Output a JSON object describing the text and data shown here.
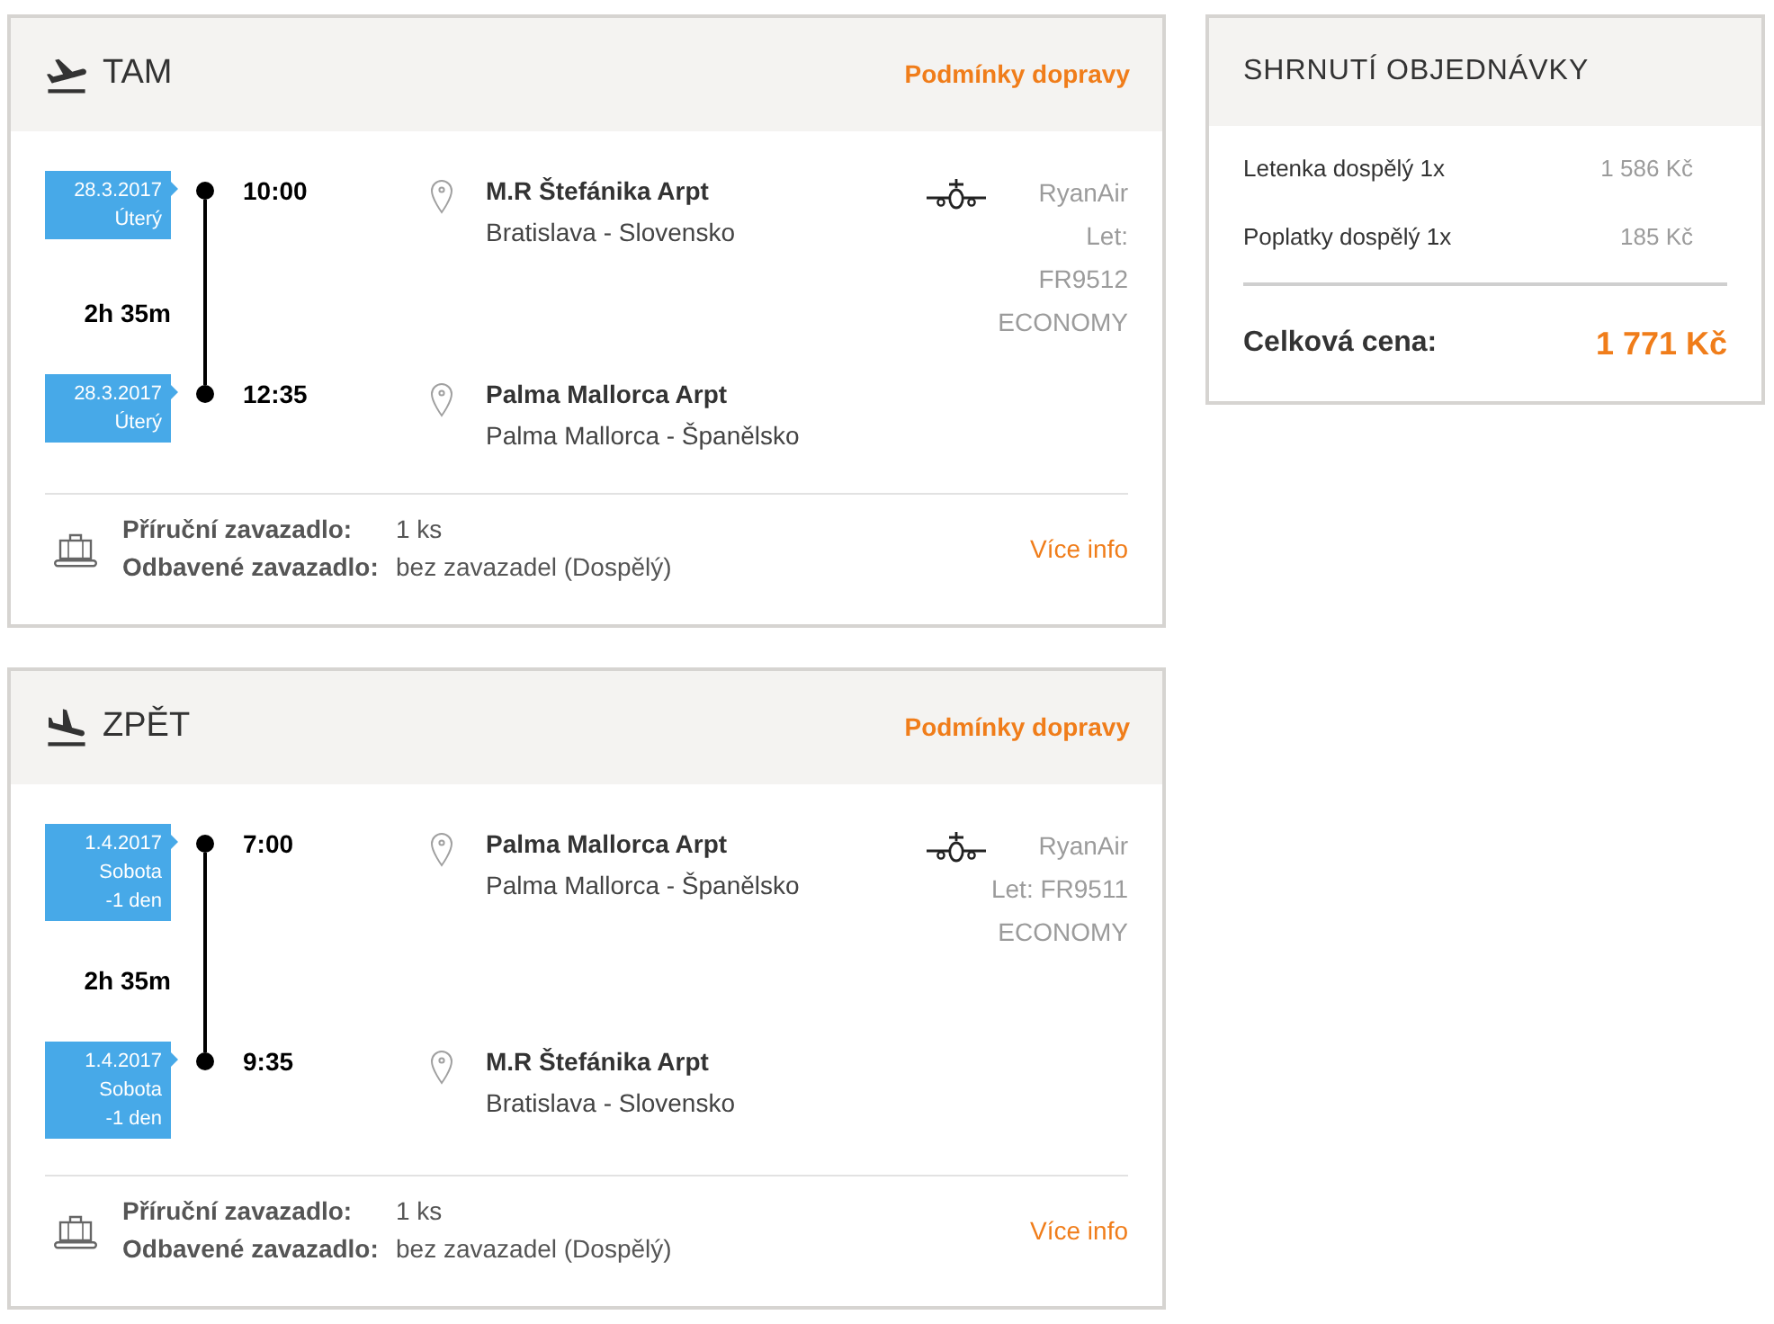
{
  "trips": [
    {
      "kind": "departure",
      "title": "TAM",
      "conditions_link": "Podmínky dopravy",
      "stops": [
        {
          "date": "28.3.2017",
          "day": "Úterý",
          "time": "10:00",
          "airport": "M.R Štefánika Arpt",
          "city": "Bratislava - Slovensko"
        },
        {
          "date": "28.3.2017",
          "day": "Úterý",
          "time": "12:35",
          "airport": "Palma Mallorca Arpt",
          "city": "Palma Mallorca - Španělsko"
        }
      ],
      "duration": "2h 35m",
      "carrier": [
        "RyanAir",
        "Let:",
        "FR9512",
        "ECONOMY"
      ],
      "baggage": [
        {
          "label": "Příruční zavazadlo:",
          "value": "1 ks"
        },
        {
          "label": "Odbavené zavazadlo:",
          "value": "bez zavazadel (Dospělý)"
        }
      ],
      "more_info": "Více info"
    },
    {
      "kind": "return",
      "title": "ZPĚT",
      "conditions_link": "Podmínky dopravy",
      "stops": [
        {
          "date": "1.4.2017",
          "day": "Sobota",
          "offset": "-1 den",
          "time": "7:00",
          "airport": "Palma Mallorca Arpt",
          "city": "Palma Mallorca - Španělsko"
        },
        {
          "date": "1.4.2017",
          "day": "Sobota",
          "offset": "-1 den",
          "time": "9:35",
          "airport": "M.R Štefánika Arpt",
          "city": "Bratislava - Slovensko"
        }
      ],
      "duration": "2h 35m",
      "carrier": [
        "RyanAir",
        "Let: FR9511",
        "ECONOMY"
      ],
      "baggage": [
        {
          "label": "Příruční zavazadlo:",
          "value": "1 ks"
        },
        {
          "label": "Odbavené zavazadlo:",
          "value": "bez zavazadel (Dospělý)"
        }
      ],
      "more_info": "Více info"
    }
  ],
  "summary": {
    "title": "SHRNUTÍ OBJEDNÁVKY",
    "items": [
      {
        "label": "Letenka dospělý 1x",
        "price": "1 586 Kč"
      },
      {
        "label": "Poplatky dospělý 1x",
        "price": "185 Kč"
      }
    ],
    "total": {
      "label": "Celková cena:",
      "price": "1 771 Kč"
    }
  }
}
